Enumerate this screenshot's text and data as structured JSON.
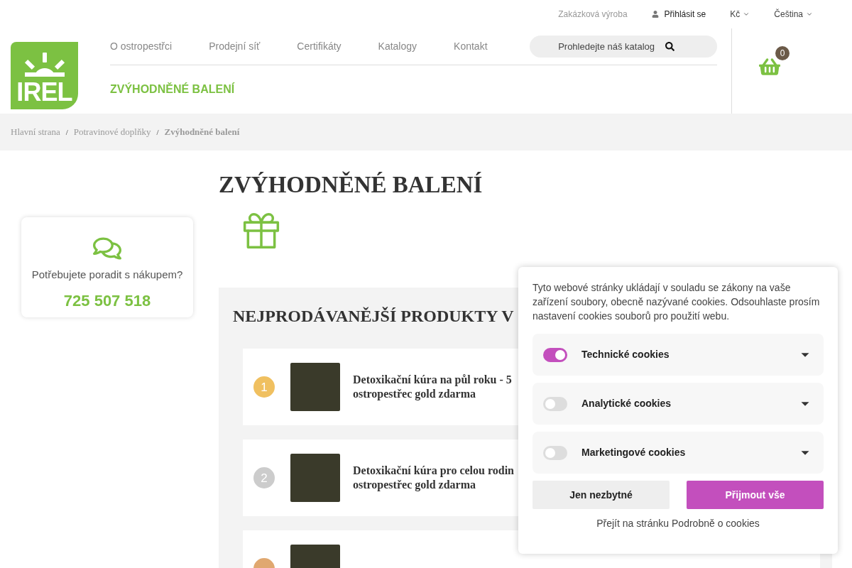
{
  "top_bar": {
    "links": [
      {
        "label": "Zakázková výroba",
        "kind": "link"
      },
      {
        "label": "Přihlásit se",
        "kind": "login"
      },
      {
        "label": "Kč",
        "kind": "dropdown"
      },
      {
        "label": "Čeština",
        "kind": "dropdown"
      }
    ]
  },
  "logo": {
    "text": "IREL"
  },
  "nav": {
    "items": [
      {
        "label": "O ostropestřci"
      },
      {
        "label": "Prodejní síť"
      },
      {
        "label": "Certifikáty"
      },
      {
        "label": "Katalogy"
      },
      {
        "label": "Kontakt"
      }
    ],
    "search": {
      "placeholder": "Prohledejte náš katalog"
    },
    "highlight": "ZVÝHODNĚNÉ BALENÍ"
  },
  "cart": {
    "count": "0"
  },
  "breadcrumb": {
    "separator": "/",
    "items": [
      {
        "label": "Hlavní strana",
        "current": false
      },
      {
        "label": "Potravinové doplňky",
        "current": false
      },
      {
        "label": "Zvýhodněné balení",
        "current": true
      }
    ]
  },
  "help_card": {
    "text": "Potřebujete poradit s nákupem?",
    "phone": "725 507 518"
  },
  "page_title": "ZVÝHODNĚNÉ BALENÍ",
  "bestsellers": {
    "title": "NEJPRODÁVANĚJŠÍ PRODUKTY V",
    "products": [
      {
        "rank": "1",
        "color": "#f0c060",
        "title_lines": [
          "Detoxikační kúra na půl roku - 5",
          "ostropestřec gold zdarma"
        ]
      },
      {
        "rank": "2",
        "color": "#cccccc",
        "title_lines": [
          "Detoxikační kúra pro celou rodin",
          "ostropestřec gold zdarma"
        ]
      },
      {
        "color": "#e0a870"
      }
    ]
  },
  "cookie_dialog": {
    "text": "Tyto webové stránky ukládají v souladu se zákony na vaše zařízení soubory, obecně nazývané cookies. Odsouhlaste prosím nastavení cookies souborů pro použití webu.",
    "categories": [
      {
        "label": "Technické cookies",
        "on": true
      },
      {
        "label": "Analytické cookies",
        "on": false
      },
      {
        "label": "Marketingové cookies",
        "on": false
      }
    ],
    "buttons": [
      {
        "label": "Jen nezbytné",
        "kind": "secondary"
      },
      {
        "label": "Přijmout vše",
        "kind": "primary"
      }
    ],
    "link": "Přejít na stránku Podrobně o cookies"
  }
}
